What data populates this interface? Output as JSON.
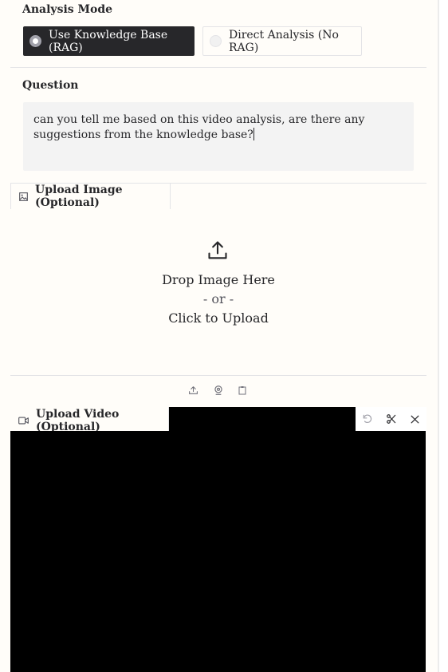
{
  "analysis_mode": {
    "label": "Analysis Mode",
    "options": [
      {
        "label": "Use Knowledge Base (RAG)",
        "selected": true
      },
      {
        "label": "Direct Analysis (No RAG)",
        "selected": false
      }
    ]
  },
  "question": {
    "label": "Question",
    "value": "can you tell me based on this video analysis, are there any suggestions from the knowledge base?"
  },
  "image_upload": {
    "tab_label": "Upload Image (Optional)",
    "drop_text": "Drop Image Here",
    "or_text": "- or -",
    "click_text": "Click to Upload",
    "sources": [
      "upload-icon",
      "webcam-icon",
      "clipboard-icon"
    ]
  },
  "video_upload": {
    "tab_label": "Upload Video (Optional)",
    "toolbar": [
      "undo-icon",
      "trim-icon",
      "close-icon"
    ]
  },
  "colors": {
    "accent": "#27272a",
    "background": "#fffdf9",
    "input_bg": "#f3f3f3",
    "border": "#e4e4e7"
  }
}
